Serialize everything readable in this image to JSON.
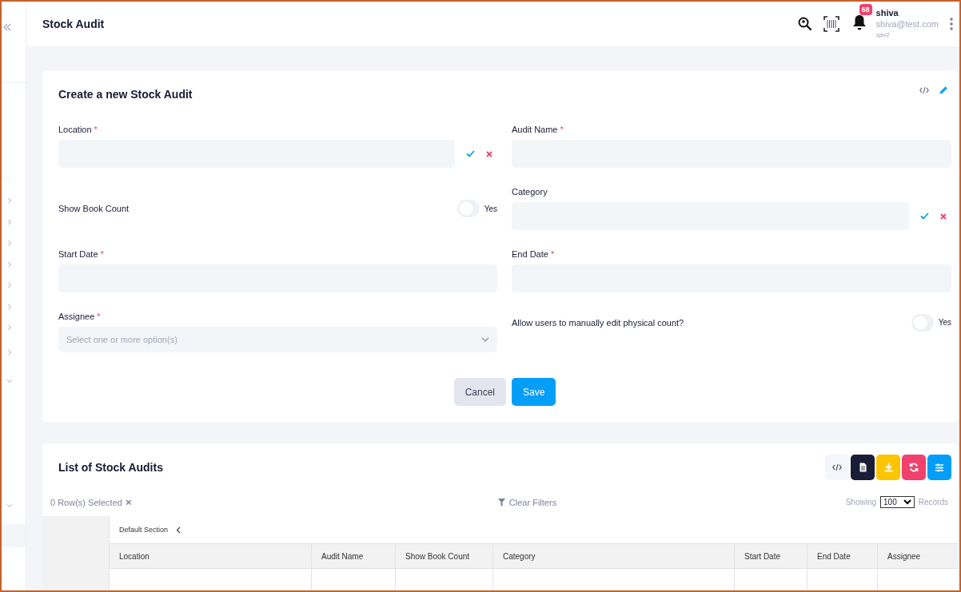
{
  "header": {
    "title": "Stock Audit",
    "notification_count": "68",
    "user": {
      "name": "shiva",
      "email": "shiva@test.com",
      "org": "qav2"
    }
  },
  "sidebar": {
    "items": [
      {
        "expanded": false
      },
      {
        "expanded": false
      },
      {
        "expanded": false
      },
      {
        "expanded": false
      },
      {
        "expanded": false
      },
      {
        "expanded": false
      },
      {
        "expanded": false
      },
      {
        "expanded": false
      },
      {
        "expanded": true
      },
      {
        "expanded": true
      }
    ]
  },
  "form": {
    "title": "Create a new Stock Audit",
    "fields": [
      {
        "kind": "text",
        "label": "Location",
        "required_mark": "*",
        "actions": true
      },
      {
        "kind": "toggle",
        "label": "Show Book Count",
        "on": false,
        "toggle_label": "Yes"
      },
      {
        "kind": "text",
        "label": "Start Date",
        "required_mark": "*",
        "actions": false
      },
      {
        "kind": "select",
        "label": "Assignee",
        "required_mark": "*",
        "placeholder": "Select one or more option(s)"
      },
      {
        "kind": "text",
        "label": "Audit Name",
        "required_mark": "*",
        "actions": false
      },
      {
        "kind": "text",
        "label": "Category",
        "actions": true
      },
      {
        "kind": "text",
        "label": "End Date",
        "required_mark": "*",
        "actions": false
      },
      {
        "kind": "toggle",
        "label": "Allow users to manually edit physical count?",
        "on": false,
        "toggle_label": "Yes"
      }
    ],
    "buttons": [
      {
        "kind": "secondary",
        "label": "Cancel"
      },
      {
        "kind": "primary",
        "label": "Save"
      }
    ]
  },
  "list": {
    "title": "List of Stock Audits",
    "tools": [
      {
        "kind": "code",
        "color": "#f3f6fa"
      },
      {
        "kind": "document",
        "color": "#1b1d36"
      },
      {
        "kind": "download",
        "color": "#fdc401"
      },
      {
        "kind": "refresh",
        "color": "#f1416c"
      },
      {
        "kind": "columns",
        "color": "#039ef7"
      }
    ],
    "selection": "0 Row(s) Selected",
    "clear_selection": "×",
    "clear_filters": "Clear Filters",
    "showing": "Showing",
    "page_size": "100",
    "records": "Records",
    "section": "Default Section",
    "columns": [
      "Location",
      "Audit Name",
      "Show Book Count",
      "Category",
      "Start Date",
      "End Date",
      "Assignee"
    ]
  }
}
